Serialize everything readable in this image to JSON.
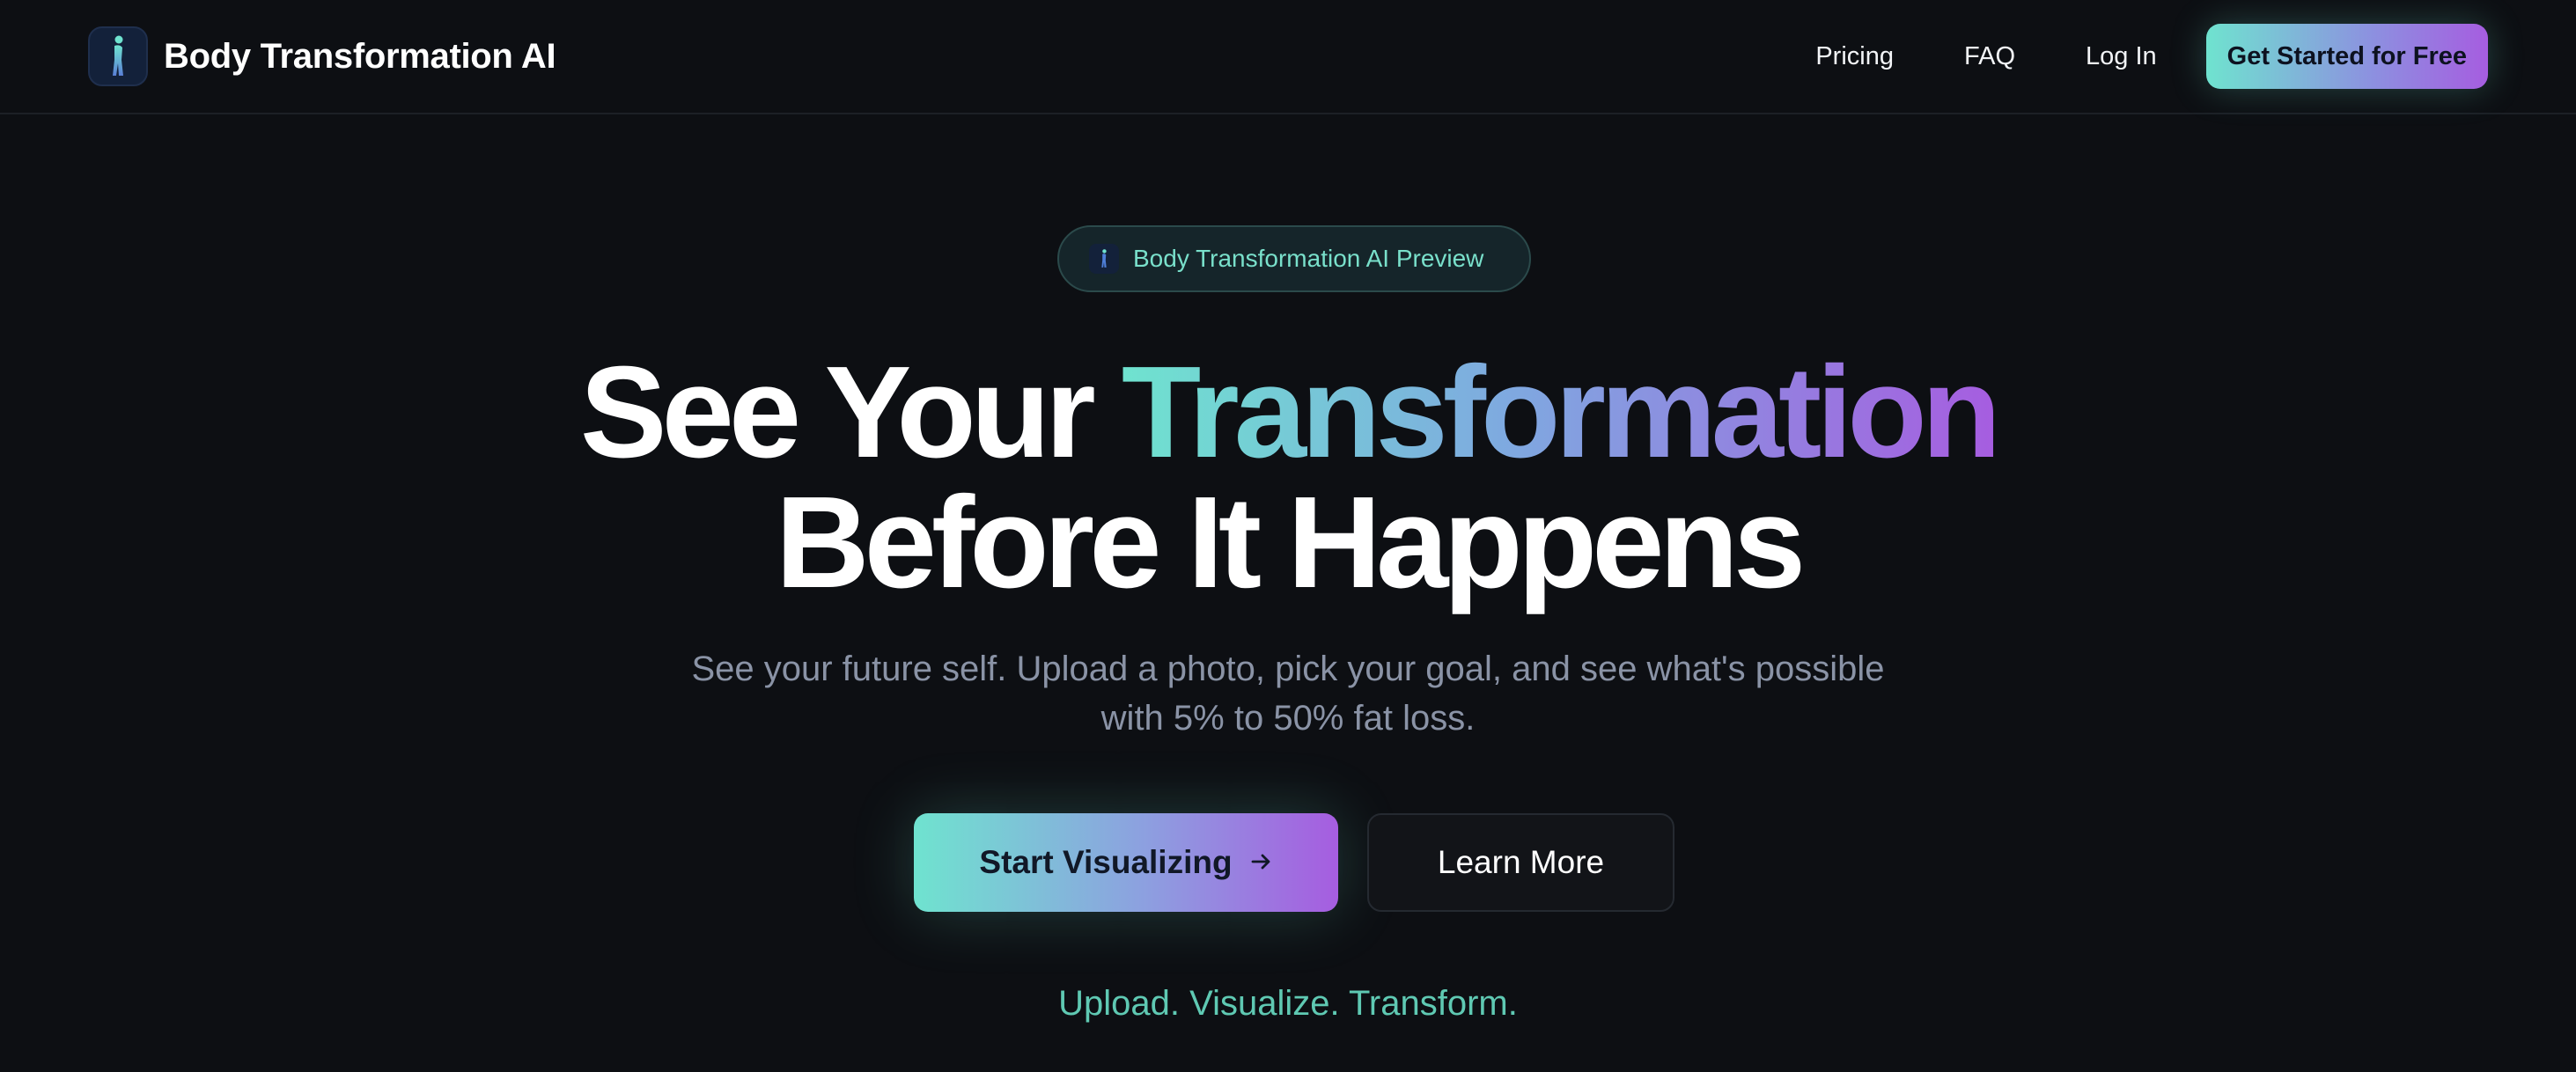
{
  "header": {
    "brand_title": "Body Transformation AI",
    "nav": {
      "pricing": "Pricing",
      "faq": "FAQ",
      "login": "Log In",
      "cta": "Get Started for Free"
    }
  },
  "hero": {
    "badge_text": "Body Transformation AI Preview",
    "headline_part1": "See Your ",
    "headline_highlight": "Transformation",
    "headline_line2": "Before It Happens",
    "subtitle_line1": "See your future self. Upload a photo, pick your goal, and see what's possible",
    "subtitle_line2": "with 5% to 50% fat loss.",
    "primary_button": "Start Visualizing",
    "secondary_button": "Learn More",
    "tagline": "Upload. Visualize. Transform."
  },
  "icons": {
    "logo": "body-figure-icon",
    "badge": "body-figure-icon",
    "primary_button": "arrow-right-icon"
  },
  "colors": {
    "background": "#0d0f13",
    "accent_teal": "#6fe3cf",
    "accent_purple": "#a65de0",
    "muted_text": "#8a93a6"
  }
}
